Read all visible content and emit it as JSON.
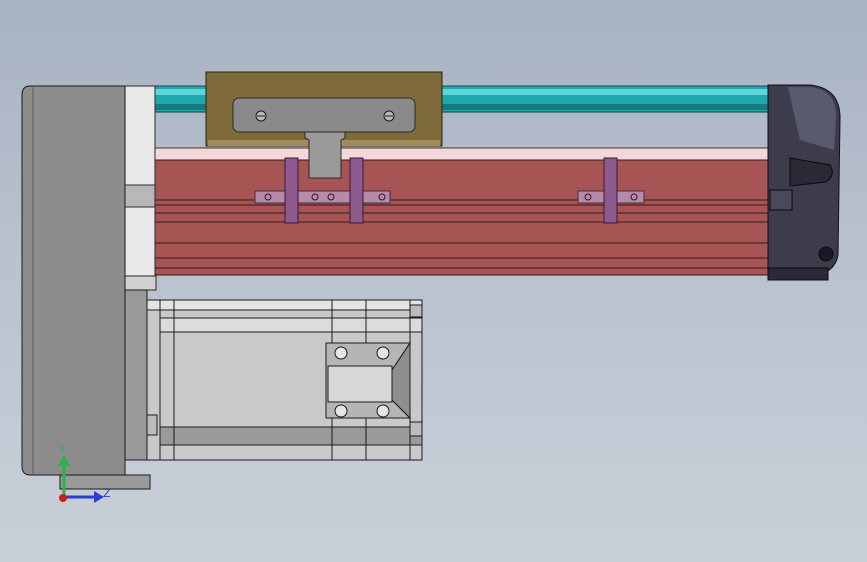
{
  "viewport": {
    "background_top": "#a7b2c2",
    "background_bottom": "#c9d0d9"
  },
  "triad": {
    "y_label": "Y",
    "z_label": "Z",
    "y_color": "#2bb34a",
    "z_color": "#2a3fd0",
    "x_color": "#d01c1c"
  },
  "colors": {
    "rail": "#1fa9ad",
    "carriage": "#7f6a3a",
    "body": "#a65454",
    "body_top_strip": "#f2d9d9",
    "end_cap": "#3c3c4c",
    "gearbox": "#8c8c8c",
    "motor": "#c9c9c9",
    "bracket": "#8c5a8c"
  }
}
